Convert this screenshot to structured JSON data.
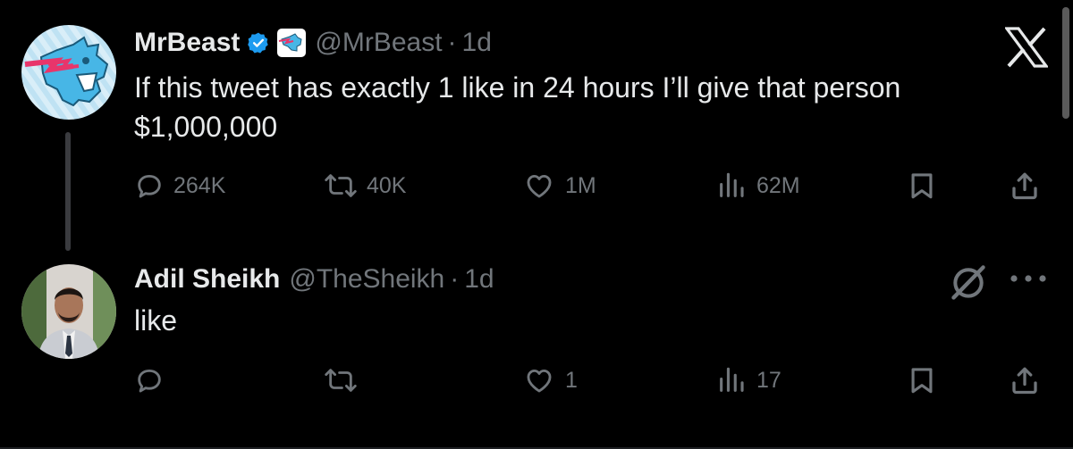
{
  "colors": {
    "background": "#000000",
    "text_primary": "#e7e9ea",
    "text_secondary": "#71767b",
    "verified": "#1d9bf0"
  },
  "tweets": [
    {
      "name": "MrBeast",
      "handle": "@MrBeast",
      "dot": "·",
      "time": "1d",
      "verified": true,
      "affiliate_badge": "mrbeast-logo-icon",
      "text_line1": "If this tweet has exactly 1 like in 24 hours I’ll give that person",
      "text_line2": "$1,000,000",
      "actions": {
        "replies": "264K",
        "reposts": "40K",
        "likes": "1M",
        "views": "62M"
      }
    },
    {
      "name": "Adil Sheikh",
      "handle": "@TheSheikh",
      "dot": "·",
      "time": "1d",
      "text": "like",
      "actions": {
        "replies": "",
        "reposts": "",
        "likes": "1",
        "views": "17"
      }
    }
  ],
  "icons": [
    "x-logo-icon",
    "reply-icon",
    "repost-icon",
    "like-icon",
    "views-icon",
    "bookmark-icon",
    "share-icon",
    "grok-icon",
    "more-icon",
    "verified-badge-icon"
  ]
}
